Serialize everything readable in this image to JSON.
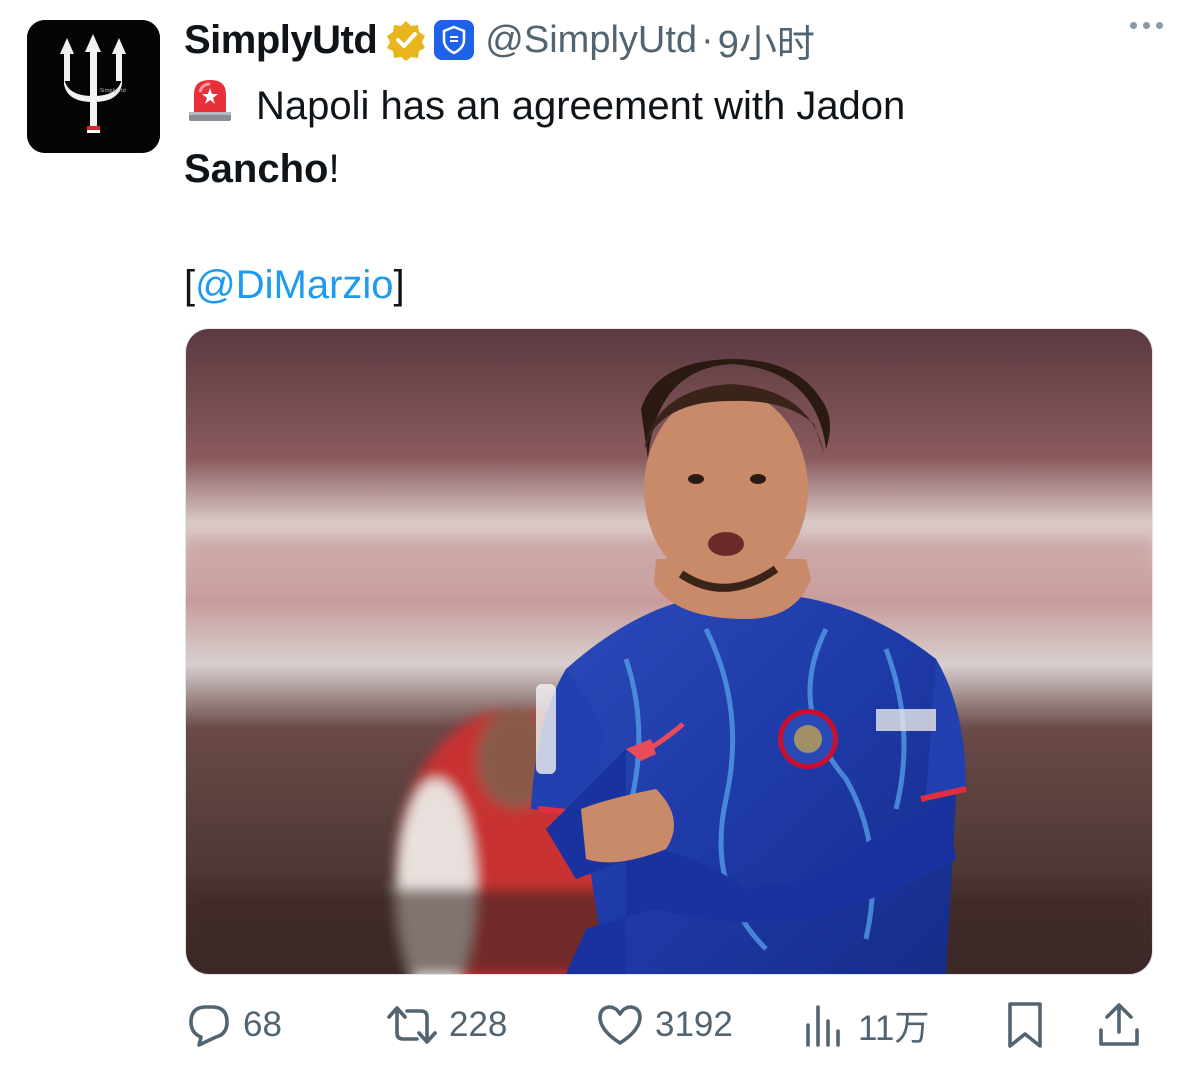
{
  "tweet": {
    "author_name": "SimplyUtd",
    "handle": "@SimplyUtd",
    "separator": "·",
    "time": "9小时",
    "text_line1": "Napoli has an agreement with Jadon",
    "text_bold": "Sancho",
    "text_after_bold": "!",
    "bracket_open": "[",
    "mention": "@DiMarzio",
    "bracket_close": "]"
  },
  "avatar": {
    "caption": "SimplyUtd"
  },
  "icons": {
    "verified": "verified-badge-icon",
    "affiliate": "shield-badge-icon",
    "siren": "rotating-light-emoji",
    "reply": "reply-icon",
    "retweet": "retweet-icon",
    "like": "heart-icon",
    "views": "views-icon",
    "bookmark": "bookmark-icon",
    "share": "share-icon"
  },
  "stats": {
    "replies": "68",
    "retweets": "228",
    "likes": "3192",
    "views": "11万"
  },
  "colors": {
    "link": "#1d9bf0",
    "secondary_text": "#536471",
    "verified_gold": "#e8b51a",
    "badge_blue": "#1d62e8"
  }
}
